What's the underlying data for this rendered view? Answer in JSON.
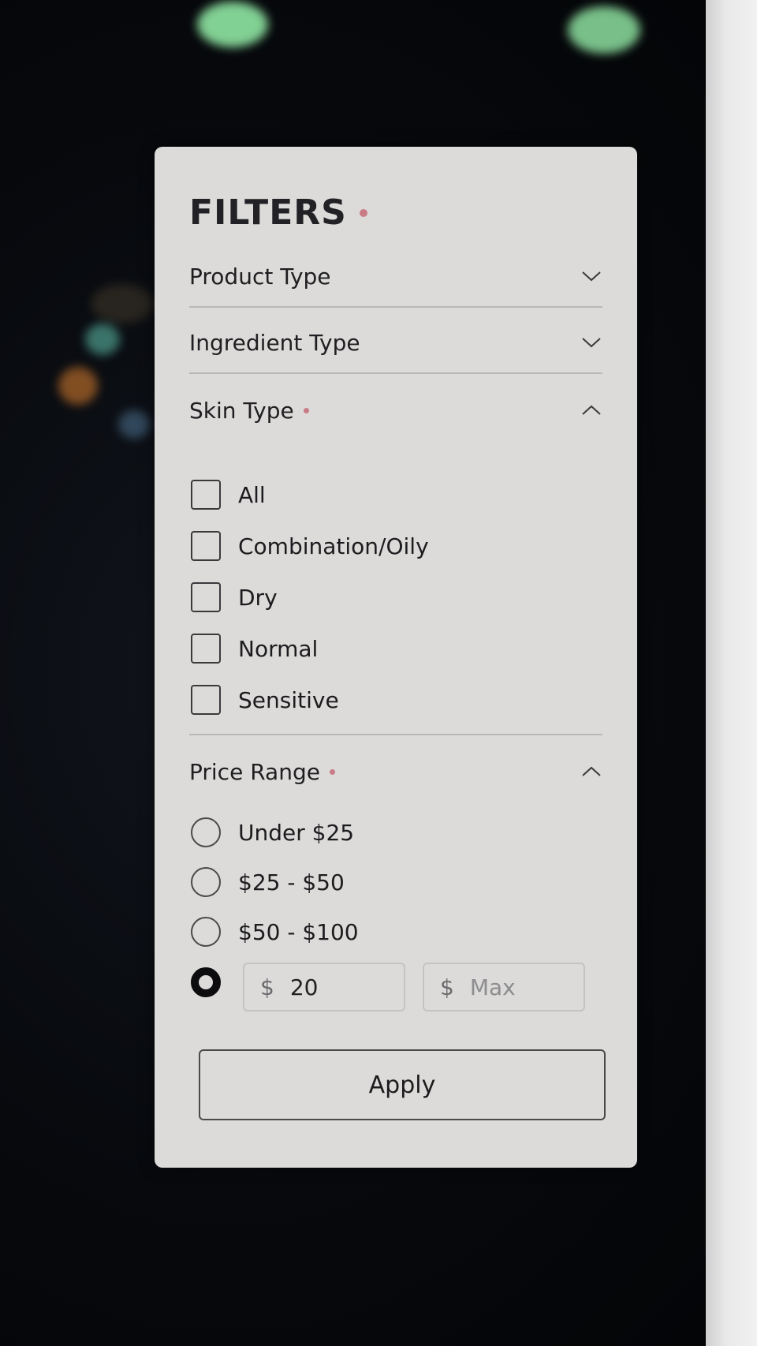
{
  "filters": {
    "title": "FILTERS",
    "accent_color": "#c97c86",
    "sections": {
      "product_type": {
        "label": "Product Type",
        "expanded": false
      },
      "ingredient_type": {
        "label": "Ingredient Type",
        "expanded": false
      },
      "skin_type": {
        "label": "Skin Type",
        "expanded": true,
        "options": [
          {
            "label": "All",
            "checked": false
          },
          {
            "label": "Combination/Oily",
            "checked": false
          },
          {
            "label": "Dry",
            "checked": false
          },
          {
            "label": "Normal",
            "checked": false
          },
          {
            "label": "Sensitive",
            "checked": false
          }
        ]
      },
      "price_range": {
        "label": "Price Range",
        "expanded": true,
        "options": [
          {
            "label": "Under $25",
            "selected": false
          },
          {
            "label": "$25 - $50",
            "selected": false
          },
          {
            "label": "$50 - $100",
            "selected": false
          }
        ],
        "custom": {
          "selected": true,
          "currency": "$",
          "min_value": "20",
          "max_placeholder": "Max"
        }
      }
    },
    "apply_label": "Apply"
  }
}
